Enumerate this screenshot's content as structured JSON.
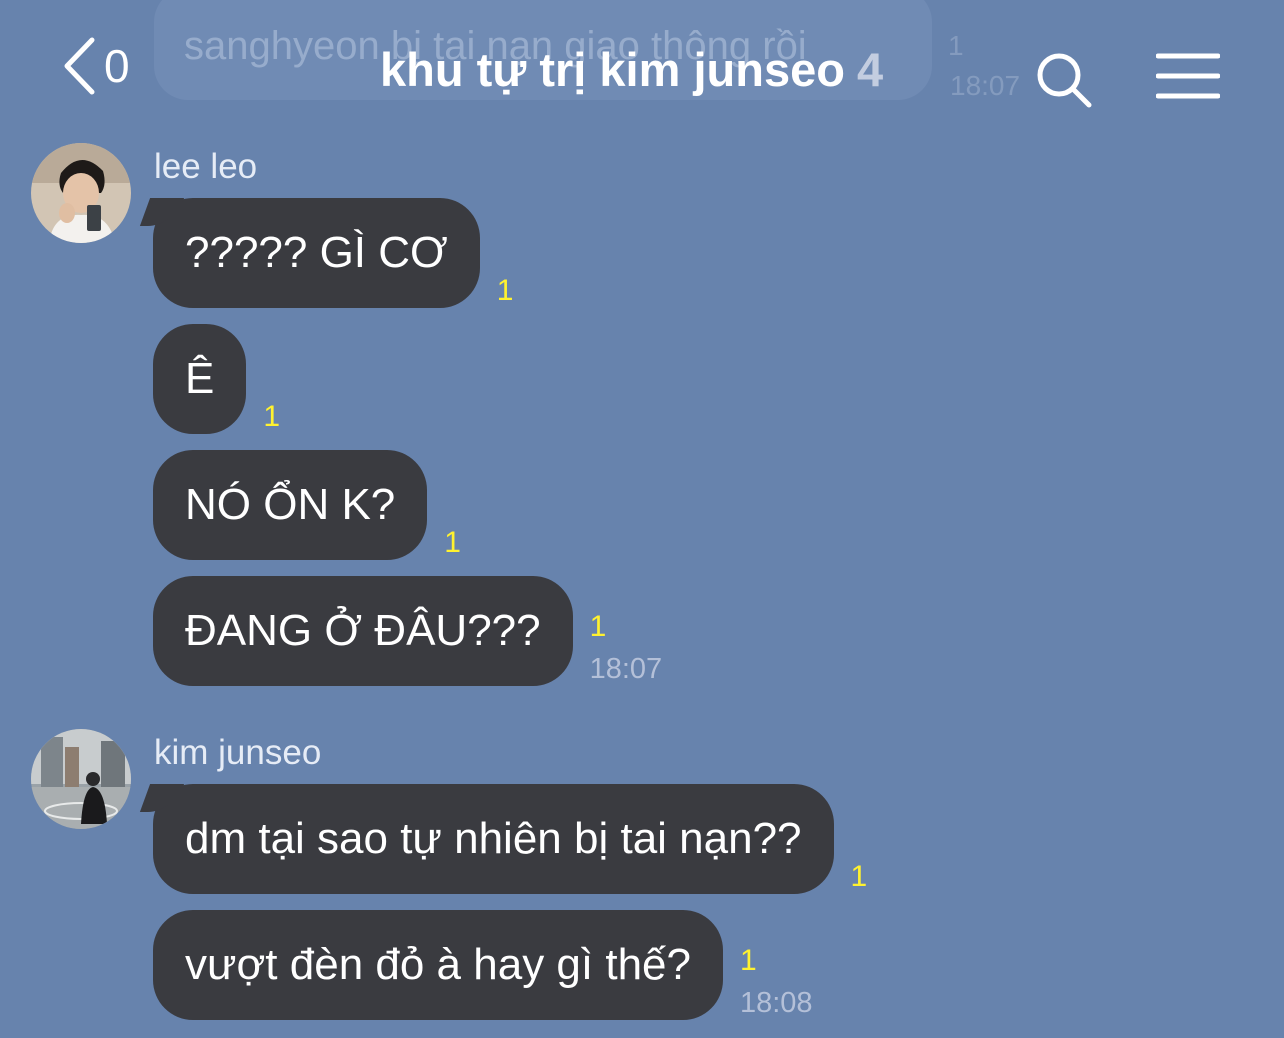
{
  "colors": {
    "background": "#6783ad",
    "bubble": "#3a3b40",
    "unread": "#fff22f"
  },
  "header": {
    "back_count": "0",
    "title": "khu tự trị kim junseo",
    "member_count": "4",
    "icons": [
      "chevron-left-icon",
      "search-icon",
      "menu-icon"
    ]
  },
  "pinned_preview": {
    "text": "sanghyeon bị tai nạn giao thông rồi",
    "unread": "1",
    "time": "18:07"
  },
  "messages": [
    {
      "sender": "lee leo",
      "items": [
        {
          "text": "????? GÌ CƠ",
          "unread": "1"
        },
        {
          "text": "Ê",
          "unread": "1"
        },
        {
          "text": "NÓ ỔN K?",
          "unread": "1"
        },
        {
          "text": "ĐANG Ở ĐÂU???",
          "unread": "1",
          "time": "18:07"
        }
      ]
    },
    {
      "sender": "kim junseo",
      "items": [
        {
          "text": "dm tại sao tự nhiên bị tai nạn??",
          "unread": "1"
        },
        {
          "text": "vượt đèn đỏ à hay gì thế?",
          "unread": "1",
          "time": "18:08"
        }
      ]
    }
  ]
}
